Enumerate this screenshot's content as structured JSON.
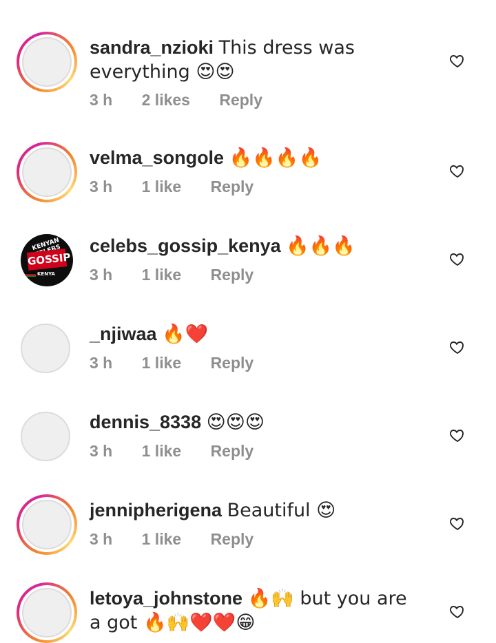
{
  "comments": [
    {
      "username": "sandra_nzioki",
      "text": "This dress was everything 😍😍",
      "time": "3 h",
      "likes": "2 likes",
      "reply": "Reply",
      "avatar": "story-ring"
    },
    {
      "username": "velma_songole",
      "text": "🔥🔥🔥🔥",
      "time": "3 h",
      "likes": "1 like",
      "reply": "Reply",
      "avatar": "story-ring"
    },
    {
      "username": "celebs_gossip_kenya",
      "text": "🔥🔥🔥",
      "time": "3 h",
      "likes": "1 like",
      "reply": "Reply",
      "avatar": "logo",
      "logo": {
        "top": "KENYAN CELEBS",
        "main": "GOSSIP",
        "bottom": "KENYA"
      }
    },
    {
      "username": "_njiwaa",
      "text": "🔥❤️",
      "time": "3 h",
      "likes": "1 like",
      "reply": "Reply",
      "avatar": "plain"
    },
    {
      "username": "dennis_8338",
      "text": "😍😍😍",
      "time": "3 h",
      "likes": "1 like",
      "reply": "Reply",
      "avatar": "plain"
    },
    {
      "username": "jennipherigena",
      "text": "Beautiful 😍",
      "time": "3 h",
      "likes": "1 like",
      "reply": "Reply",
      "avatar": "story-ring"
    },
    {
      "username": "letoya_johnstone",
      "text": "🔥🙌 but you are a got 🔥🙌❤️❤️😁",
      "time": "",
      "likes": "",
      "reply": "",
      "avatar": "story-ring"
    }
  ],
  "icons": {
    "like": "heart-outline-icon"
  },
  "colors": {
    "username": "#262626",
    "meta": "#8e8e8e",
    "heart": "#262626"
  }
}
